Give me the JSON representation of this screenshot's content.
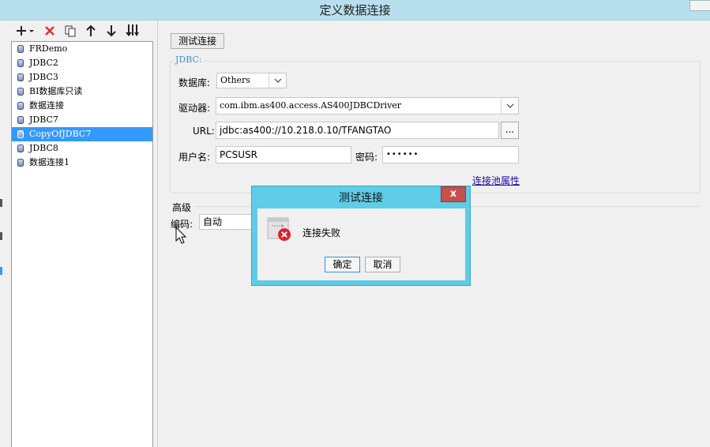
{
  "window": {
    "title": "定义数据连接"
  },
  "toolbar": {
    "add_icon": "plus-dropdown-icon",
    "delete_icon": "red-x-icon",
    "copy_icon": "copy-icon",
    "up_icon": "arrow-up-icon",
    "down_icon": "arrow-down-icon",
    "sort_icon": "sort-down-icon"
  },
  "connections": [
    {
      "label": "FRDemo"
    },
    {
      "label": "JDBC2"
    },
    {
      "label": "JDBC3"
    },
    {
      "label": "BI数据库只读"
    },
    {
      "label": "数据连接"
    },
    {
      "label": "JDBC7"
    },
    {
      "label": "CopyOfJDBC7",
      "selected": true
    },
    {
      "label": "JDBC8"
    },
    {
      "label": "数据连接1"
    }
  ],
  "test_button": "测试连接",
  "jdbc": {
    "legend": "JDBC:",
    "database_label": "数据库:",
    "database_value": "Others",
    "driver_label": "驱动器:",
    "driver_value": "com.ibm.as400.access.AS400JDBCDriver",
    "url_label": "URL:",
    "url_value": "jdbc:as400://10.218.0.10/TFANGTAO",
    "url_browse": "...",
    "user_label": "用户名:",
    "user_value": "PCSUSR",
    "password_label": "密码:",
    "password_value": "••••••",
    "pool_link": "连接池属性"
  },
  "advanced": {
    "heading": "高级",
    "encoding_label": "编码:",
    "encoding_value": "自动"
  },
  "dialog": {
    "title": "测试连接",
    "close_label": "x",
    "message": "连接失败",
    "ok": "确定",
    "cancel": "取消"
  },
  "colors": {
    "titlebar": "#b8dfee",
    "selection": "#3399ff",
    "dialog_frame": "#5fcce8",
    "dialog_close": "#c8504c",
    "link": "#1a0dab",
    "legend": "#4d8fd3"
  }
}
